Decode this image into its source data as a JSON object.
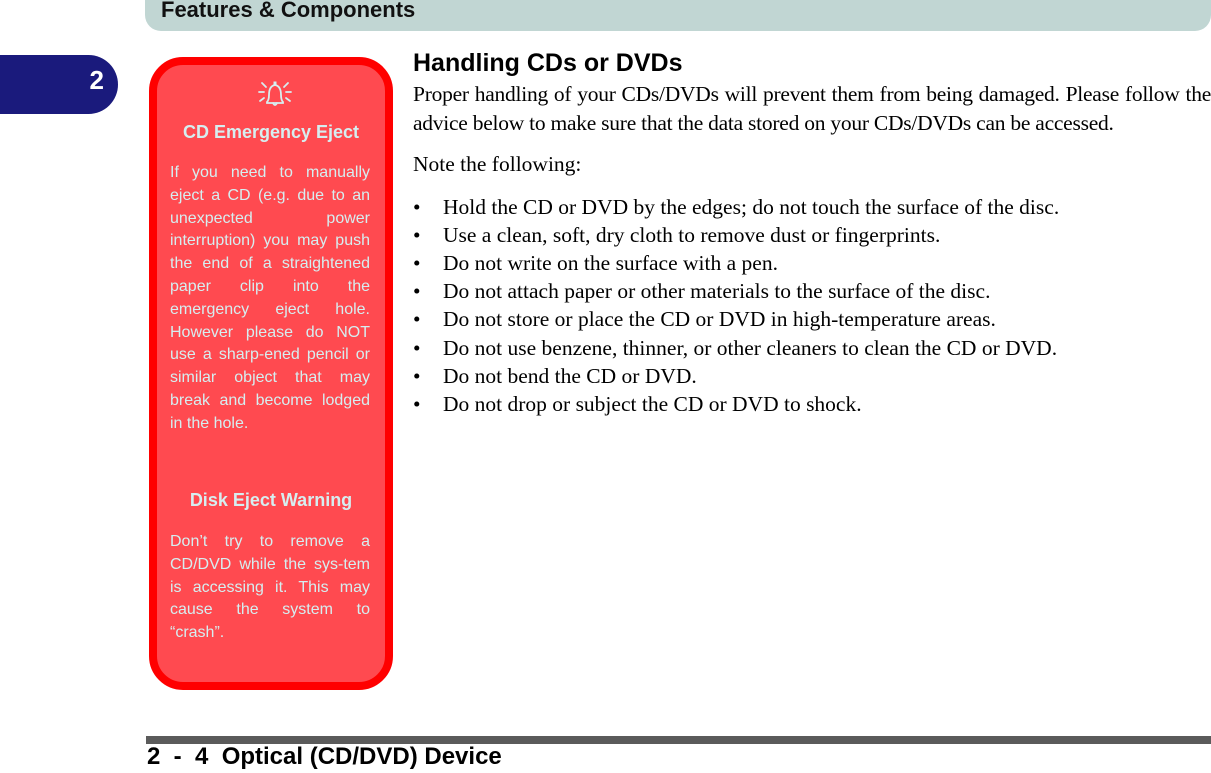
{
  "header": {
    "title": "Features & Components"
  },
  "chapter_tab": {
    "number": "2"
  },
  "sidebar": {
    "icon": "bell-alert-icon",
    "colors": {
      "fill": "#ff4a50",
      "border": "#ff0000",
      "text": "#d6eef0"
    },
    "sections": [
      {
        "title": "CD Emergency Eject",
        "text": "If you need to manually eject a CD (e.g. due to an unexpected power interruption) you may push the end of a straightened paper clip into the emergency eject hole. However please do NOT use a sharp-ened pencil or similar object that may break and become lodged in the hole."
      },
      {
        "title": "Disk Eject Warning",
        "text": "Don’t try to remove a CD/DVD while the sys-tem is accessing it. This may cause the system to “crash”."
      }
    ]
  },
  "main": {
    "title": "Handling CDs or DVDs",
    "intro": "Proper handling of your CDs/DVDs will prevent them from being damaged. Please follow the advice below to make sure that the data stored on your CDs/DVDs can be accessed.",
    "note": "Note the following:",
    "bullet_symbol": "•",
    "bullets": [
      "Hold the CD or DVD by the edges; do not touch the surface of the disc.",
      "Use a clean, soft, dry cloth to remove dust or fingerprints.",
      "Do not write on the surface with a pen.",
      "Do not attach paper or other materials to the surface of the disc.",
      "Do not store or place the CD or DVD in high-temperature areas.",
      "Do not use benzene, thinner, or other cleaners to clean the CD or DVD.",
      "Do not bend the CD or DVD.",
      "Do not drop or subject the CD or DVD to shock."
    ]
  },
  "footer": {
    "page_label": "2  -  4  Optical (CD/DVD) Device"
  }
}
